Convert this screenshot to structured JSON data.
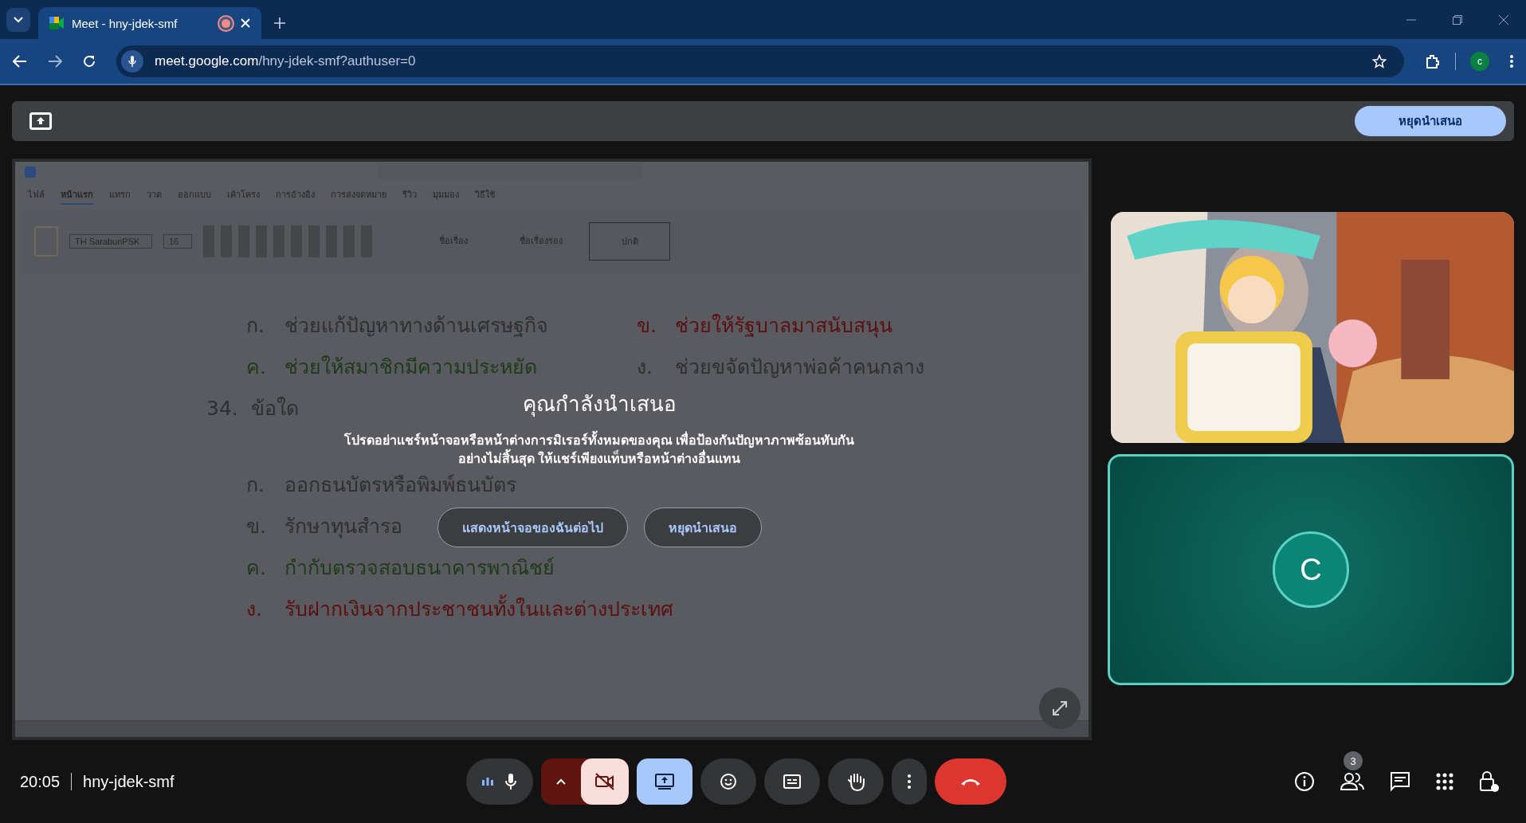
{
  "browser": {
    "tab": {
      "title": "Meet - hny-jdek-smf",
      "recording": true
    },
    "url": {
      "host": "meet.google.com",
      "path": "/hny-jdek-smf?authuser=0"
    },
    "profile_initial": "c"
  },
  "presenting_bar": {
    "stop_button": "หยุดนำเสนอ"
  },
  "shared_document": {
    "ribbon_tabs": [
      {
        "label": "ไฟล์",
        "selected": false
      },
      {
        "label": "หน้าแรก",
        "selected": true
      },
      {
        "label": "แทรก",
        "selected": false
      },
      {
        "label": "วาด",
        "selected": false
      },
      {
        "label": "ออกแบบ",
        "selected": false
      },
      {
        "label": "เค้าโครง",
        "selected": false
      },
      {
        "label": "การอ้างอิง",
        "selected": false
      },
      {
        "label": "การส่งจดหมาย",
        "selected": false
      },
      {
        "label": "รีวิว",
        "selected": false
      },
      {
        "label": "มุมมอง",
        "selected": false
      },
      {
        "label": "วิธีใช้",
        "selected": false
      }
    ],
    "font_name": "TH SarabunPSK",
    "font_size": "16",
    "styles": [
      {
        "label": "ชื่อเรื่อง",
        "selected": false
      },
      {
        "label": "ชื่อเรื่องรอง",
        "selected": false
      },
      {
        "label": "ปกติ",
        "selected": true
      }
    ],
    "rows": [
      {
        "kind": "options",
        "items": [
          {
            "letter": "ก.",
            "text": "ช่วยแก้ปัญหาทางด้านเศรษฐกิจ",
            "color": "#2e2f32"
          },
          {
            "letter": "ข.",
            "text": "ช่วยให้รัฐบาลมาสนับสนุน",
            "color": "#5a1010"
          }
        ]
      },
      {
        "kind": "options",
        "items": [
          {
            "letter": "ค.",
            "text": "ช่วยให้สมาชิกมีความประหยัด",
            "color": "#1f3a1a"
          },
          {
            "letter": "ง.",
            "text": "ช่วยขจัดปัญหาพ่อค้าคนกลาง",
            "color": "#2e2f32"
          }
        ]
      },
      {
        "kind": "question",
        "number": "34.",
        "text": "ข้อใด"
      },
      {
        "kind": "option",
        "letter": "ก.",
        "text": "ออกธนบัตรหรือพิมพ์ธนบัตร",
        "color": "#2e2f32"
      },
      {
        "kind": "option",
        "letter": "ข.",
        "text": "รักษาทุนสำรอ",
        "color": "#2e2f32"
      },
      {
        "kind": "option",
        "letter": "ค.",
        "text": "กำกับตรวจสอบธนาคารพาณิชย์",
        "color": "#1f3a1a"
      },
      {
        "kind": "option",
        "letter": "ง.",
        "text": "รับฝากเงินจากประชาชนทั้งในและต่างประเทศ",
        "color": "#5a1010"
      }
    ]
  },
  "presenting_notice": {
    "title": "คุณกำลังนำเสนอ",
    "message": "โปรดอย่าแชร์หน้าจอหรือหน้าต่างการมิเรอร์ทั้งหมดของคุณ เพื่อป้องกันปัญหาภาพซ้อนทับกันอย่างไม่สิ้นสุด ให้แชร์เพียงแท็บหรือหน้าต่างอื่นแทน",
    "buttons": [
      "แสดงหน้าจอของฉันต่อไป",
      "หยุดนำเสนอ"
    ]
  },
  "participants": [
    {
      "kind": "video"
    },
    {
      "kind": "avatar",
      "initial": "C",
      "speaking": true
    }
  ],
  "bottom_bar": {
    "time": "20:05",
    "meeting_code": "hny-jdek-smf",
    "controls": [
      {
        "kind": "mic",
        "on": true
      },
      {
        "kind": "camera",
        "on": false
      },
      {
        "kind": "present",
        "on": true
      },
      {
        "kind": "emoji",
        "on": false
      },
      {
        "kind": "captions",
        "on": false
      },
      {
        "kind": "hand",
        "on": false
      },
      {
        "kind": "more",
        "on": false
      },
      {
        "kind": "leave",
        "on": false
      }
    ],
    "participant_count": "3"
  }
}
